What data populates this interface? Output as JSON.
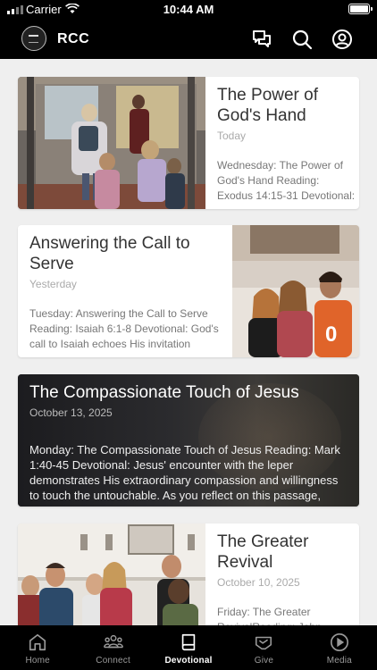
{
  "status_bar": {
    "carrier": "Carrier",
    "time": "10:44 AM"
  },
  "header": {
    "title": "RCC",
    "icons": [
      "chat-icon",
      "search-icon",
      "profile-icon"
    ]
  },
  "devotionals": [
    {
      "title": "The Power of God's Hand",
      "date": "Today",
      "excerpt": "Wednesday: The Power of God's Hand Reading: Exodus 14:15-31 Devotional:"
    },
    {
      "title": "Answering the Call to Serve",
      "date": "Yesterday",
      "excerpt": "Tuesday: Answering the Call to Serve Reading: Isaiah 6:1-8 Devotional: God's call to Isaiah echoes His invitation"
    },
    {
      "title": "The Compassionate Touch of Jesus",
      "date": "October 13, 2025",
      "excerpt": "Monday: The Compassionate Touch of Jesus Reading: Mark 1:40-45 Devotional: Jesus' encounter with the leper demonstrates His extraordinary compassion and willingness to touch the untouchable. As you reflect on this passage, consider"
    },
    {
      "title": "The Greater Revival",
      "date": "October 10, 2025",
      "excerpt": "Friday: The Greater RevivalReading: John"
    }
  ],
  "tabbar": {
    "active": "Devotional",
    "tabs": [
      {
        "label": "Home",
        "icon": "home-icon"
      },
      {
        "label": "Connect",
        "icon": "people-icon"
      },
      {
        "label": "Devotional",
        "icon": "book-icon"
      },
      {
        "label": "Give",
        "icon": "give-hand-icon"
      },
      {
        "label": "Media",
        "icon": "play-icon"
      }
    ]
  },
  "colors": {
    "bar_bg": "#000000",
    "feed_bg": "#efefef",
    "inactive_tab": "#9a9a9a",
    "active_tab": "#ffffff"
  }
}
